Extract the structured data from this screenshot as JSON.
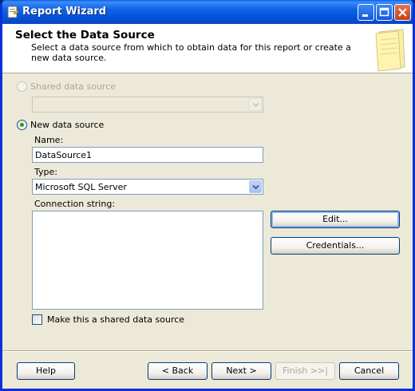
{
  "window": {
    "title": "Report Wizard"
  },
  "header": {
    "title": "Select the Data Source",
    "description": "Select a data source from which to obtain data for this report or create a new data source."
  },
  "shared_source": {
    "label": "Shared data source",
    "selected": false,
    "enabled": false,
    "value": ""
  },
  "new_source": {
    "label": "New data source",
    "selected": true,
    "name_label": "Name:",
    "name_value": "DataSource1",
    "type_label": "Type:",
    "type_value": "Microsoft SQL Server",
    "connection_label": "Connection string:",
    "connection_value": "",
    "edit_button": "Edit...",
    "credentials_button": "Credentials...",
    "shared_checkbox_label": "Make this a shared data source",
    "shared_checkbox_checked": false
  },
  "footer": {
    "help": "Help",
    "back": "< Back",
    "next": "Next >",
    "finish": "Finish >>|",
    "cancel": "Cancel"
  },
  "colors": {
    "title_bar": "#0a5fe8",
    "dialog_bg": "#ece9d8",
    "radio_dot": "#21a121"
  }
}
